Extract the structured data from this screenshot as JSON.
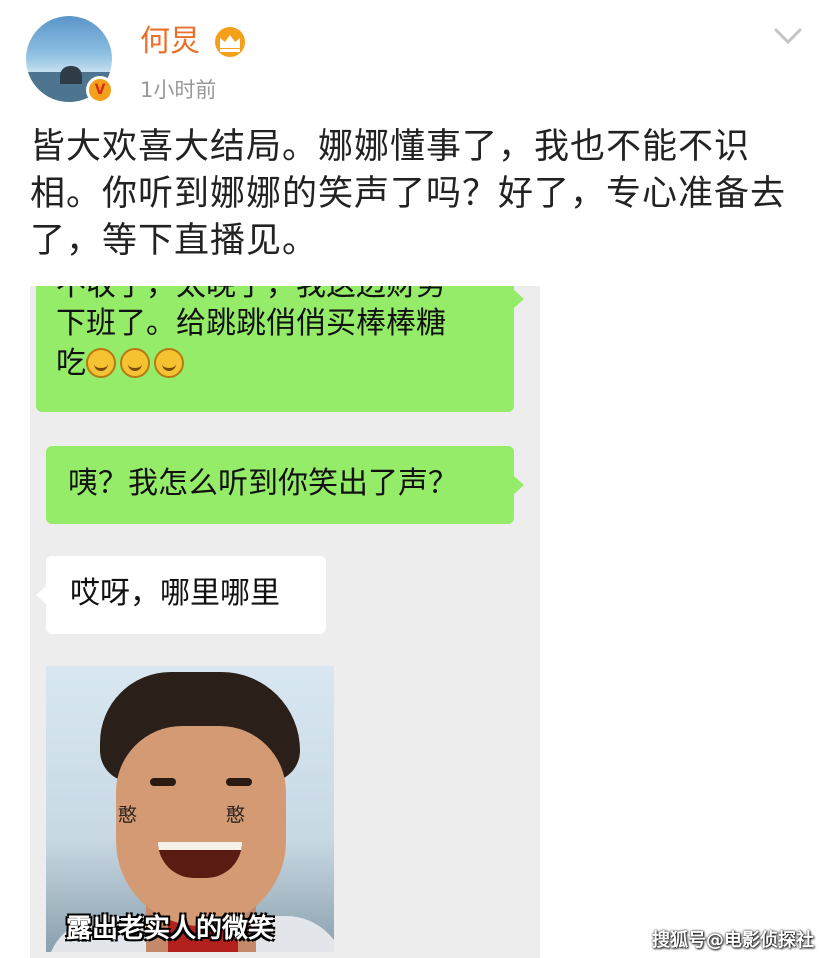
{
  "header": {
    "username": "何炅",
    "timestamp": "1小时前",
    "avatar_badge": "V",
    "icons": [
      "crown-icon",
      "chevron-down-icon",
      "verified-icon"
    ]
  },
  "post": {
    "text": "皆大欢喜大结局。娜娜懂事了，我也不能不识相。你听到娜娜的笑声了吗？好了，专心准备去了，等下直播见。"
  },
  "chat": {
    "bubble1": {
      "line1": "不收了，太晚了，我这边财务",
      "line2": "下班了。给跳跳俏俏买棒棒糖",
      "line3": "吃"
    },
    "bubble2": "咦？我怎么听到你笑出了声？",
    "bubble3": "哎呀，哪里哪里",
    "meme": {
      "cheek_left": "憨",
      "cheek_right": "憨",
      "caption": "露出老实人的微笑"
    }
  },
  "watermark": "搜狐号@电影侦探社",
  "colors": {
    "username": "#e8702a",
    "green_bubble": "#95ec69",
    "chat_background": "#ededed",
    "crown": "#f5a01a"
  }
}
